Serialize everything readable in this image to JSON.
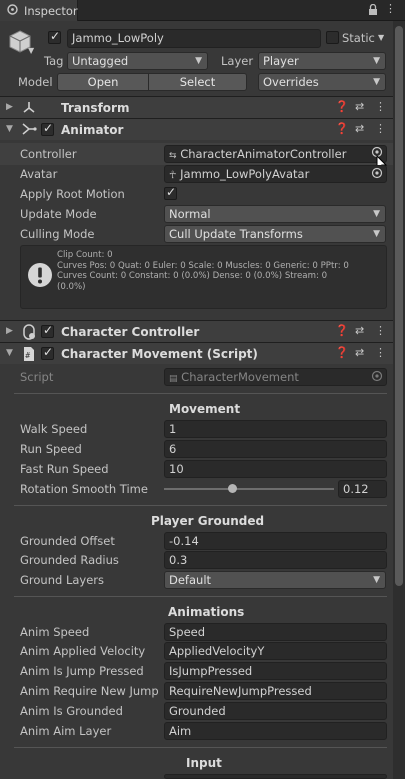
{
  "tab": {
    "title": "Inspector"
  },
  "object": {
    "name": "Jammo_LowPoly",
    "static_label": "Static",
    "tag_label": "Tag",
    "tag_value": "Untagged",
    "layer_label": "Layer",
    "layer_value": "Player",
    "model_label": "Model",
    "open_label": "Open",
    "select_label": "Select",
    "overrides_label": "Overrides"
  },
  "transform": {
    "title": "Transform"
  },
  "animator": {
    "title": "Animator",
    "controller_label": "Controller",
    "controller_value": "CharacterAnimatorController",
    "avatar_label": "Avatar",
    "avatar_value": "Jammo_LowPolyAvatar",
    "apply_root_motion_label": "Apply Root Motion",
    "update_mode_label": "Update Mode",
    "update_mode_value": "Normal",
    "culling_mode_label": "Culling Mode",
    "culling_mode_value": "Cull Update Transforms",
    "info": [
      "Clip Count: 0",
      "Curves Pos: 0 Quat: 0 Euler: 0 Scale: 0 Muscles: 0 Generic: 0 PPtr: 0",
      "Curves Count: 0 Constant: 0 (0.0%) Dense: 0 (0.0%) Stream: 0",
      "(0.0%)"
    ]
  },
  "character_controller": {
    "title": "Character Controller"
  },
  "character_movement": {
    "title": "Character Movement (Script)",
    "script_label": "Script",
    "script_value": "CharacterMovement",
    "sections": {
      "movement": "Movement",
      "player_grounded": "Player Grounded",
      "animations": "Animations",
      "input": "Input"
    },
    "walk_speed_label": "Walk Speed",
    "walk_speed": "1",
    "run_speed_label": "Run Speed",
    "run_speed": "6",
    "fast_run_speed_label": "Fast Run Speed",
    "fast_run_speed": "10",
    "rotation_smooth_time_label": "Rotation Smooth Time",
    "rotation_smooth_time": "0.12",
    "rotation_smooth_slider_fraction": 0.4,
    "grounded_offset_label": "Grounded Offset",
    "grounded_offset": "-0.14",
    "grounded_radius_label": "Grounded Radius",
    "grounded_radius": "0.3",
    "ground_layers_label": "Ground Layers",
    "ground_layers": "Default",
    "anim_speed_label": "Anim Speed",
    "anim_speed": "Speed",
    "anim_applied_velocity_label": "Anim Applied Velocity",
    "anim_applied_velocity": "AppliedVelocityY",
    "anim_is_jump_pressed_label": "Anim Is Jump Pressed",
    "anim_is_jump_pressed": "IsJumpPressed",
    "anim_require_new_jump_label": "Anim Require New Jump",
    "anim_require_new_jump": "RequireNewJumpPressed",
    "anim_is_grounded_label": "Anim Is Grounded",
    "anim_is_grounded": "Grounded",
    "anim_aim_layer_label": "Anim Aim Layer",
    "anim_aim_layer": "Aim"
  },
  "icons": [
    "inspector-icon",
    "lock-icon",
    "menu-icon",
    "cube-icon",
    "help-icon",
    "preset-icon",
    "kebab-icon",
    "object-picker-icon",
    "info-icon"
  ],
  "colors": {
    "panel": "#383838",
    "field": "#2a2a2a",
    "header": "#3e3e3e",
    "tabbar": "#282828"
  }
}
